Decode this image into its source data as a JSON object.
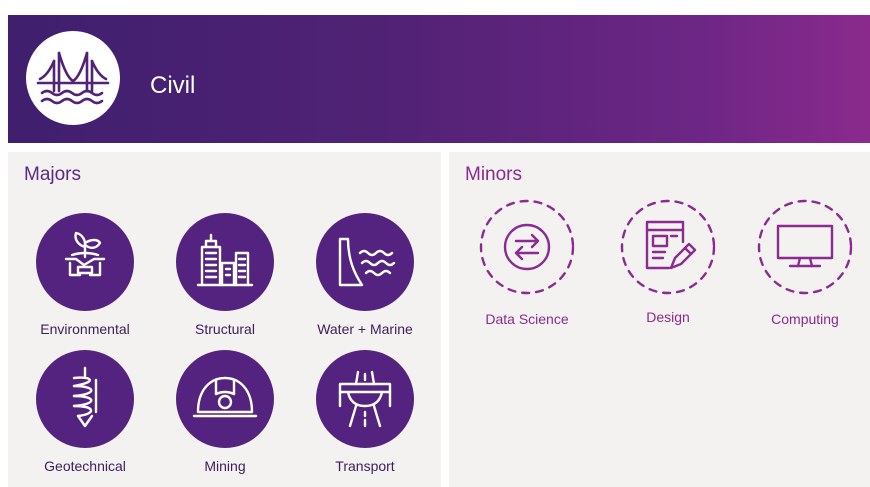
{
  "header": {
    "title": "Civil",
    "logo_icon": "bridge-water-icon"
  },
  "majors": {
    "title": "Majors",
    "items": [
      {
        "label": "Environmental",
        "icon": "plant-handshake-icon"
      },
      {
        "label": "Structural",
        "icon": "buildings-icon"
      },
      {
        "label": "Water + Marine",
        "icon": "dam-waves-icon"
      },
      {
        "label": "Geotechnical",
        "icon": "drill-auger-icon"
      },
      {
        "label": "Mining",
        "icon": "hard-hat-icon"
      },
      {
        "label": "Transport",
        "icon": "road-bridge-icon"
      }
    ]
  },
  "minors": {
    "title": "Minors",
    "items": [
      {
        "label": "Data Science",
        "icon": "exchange-arrows-icon"
      },
      {
        "label": "Design",
        "icon": "layout-pencil-icon"
      },
      {
        "label": "Computing",
        "icon": "monitor-icon"
      }
    ]
  },
  "colors": {
    "brand_dark": "#3f1f6e",
    "brand_magenta": "#8a2a8d",
    "major_circle": "#542380",
    "minor_dashed": "#8b2a8f",
    "panel_bg": "#f3f2f1"
  }
}
